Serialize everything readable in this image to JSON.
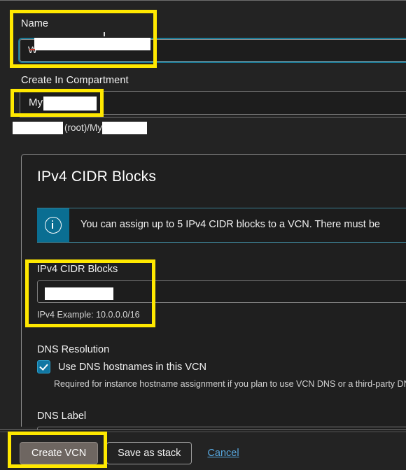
{
  "form": {
    "name": {
      "label": "Name",
      "value_prefix": "W",
      "redacted": true
    },
    "compartment": {
      "label": "Create In Compartment",
      "value_prefix": "My",
      "path_middle": "(root)/My",
      "redacted": true
    }
  },
  "card": {
    "title": "IPv4 CIDR Blocks",
    "banner": {
      "icon": "info-circle-icon",
      "text": "You can assign up to 5 IPv4 CIDR blocks to a VCN. There must be",
      "accent_color": "#0a6e92"
    },
    "cidr": {
      "label": "IPv4 CIDR Blocks",
      "value": "",
      "help": "IPv4 Example: 10.0.0.0/16"
    },
    "dns": {
      "resolution_label": "DNS Resolution",
      "checkbox_label": "Use DNS hostnames in this VCN",
      "checkbox_checked": true,
      "help": "Required for instance hostname assignment if you plan to use VCN DNS or a third-party DN",
      "label_label": "DNS Label",
      "label_value": ""
    }
  },
  "footer": {
    "primary_button": "Create VCN",
    "secondary_button": "Save as stack",
    "cancel_link": "Cancel"
  },
  "highlights": {
    "accent_color": "#ffe800",
    "items": [
      "name-field",
      "compartment-field",
      "ipv4-cidr-blocks-field",
      "create-vcn-button"
    ]
  }
}
